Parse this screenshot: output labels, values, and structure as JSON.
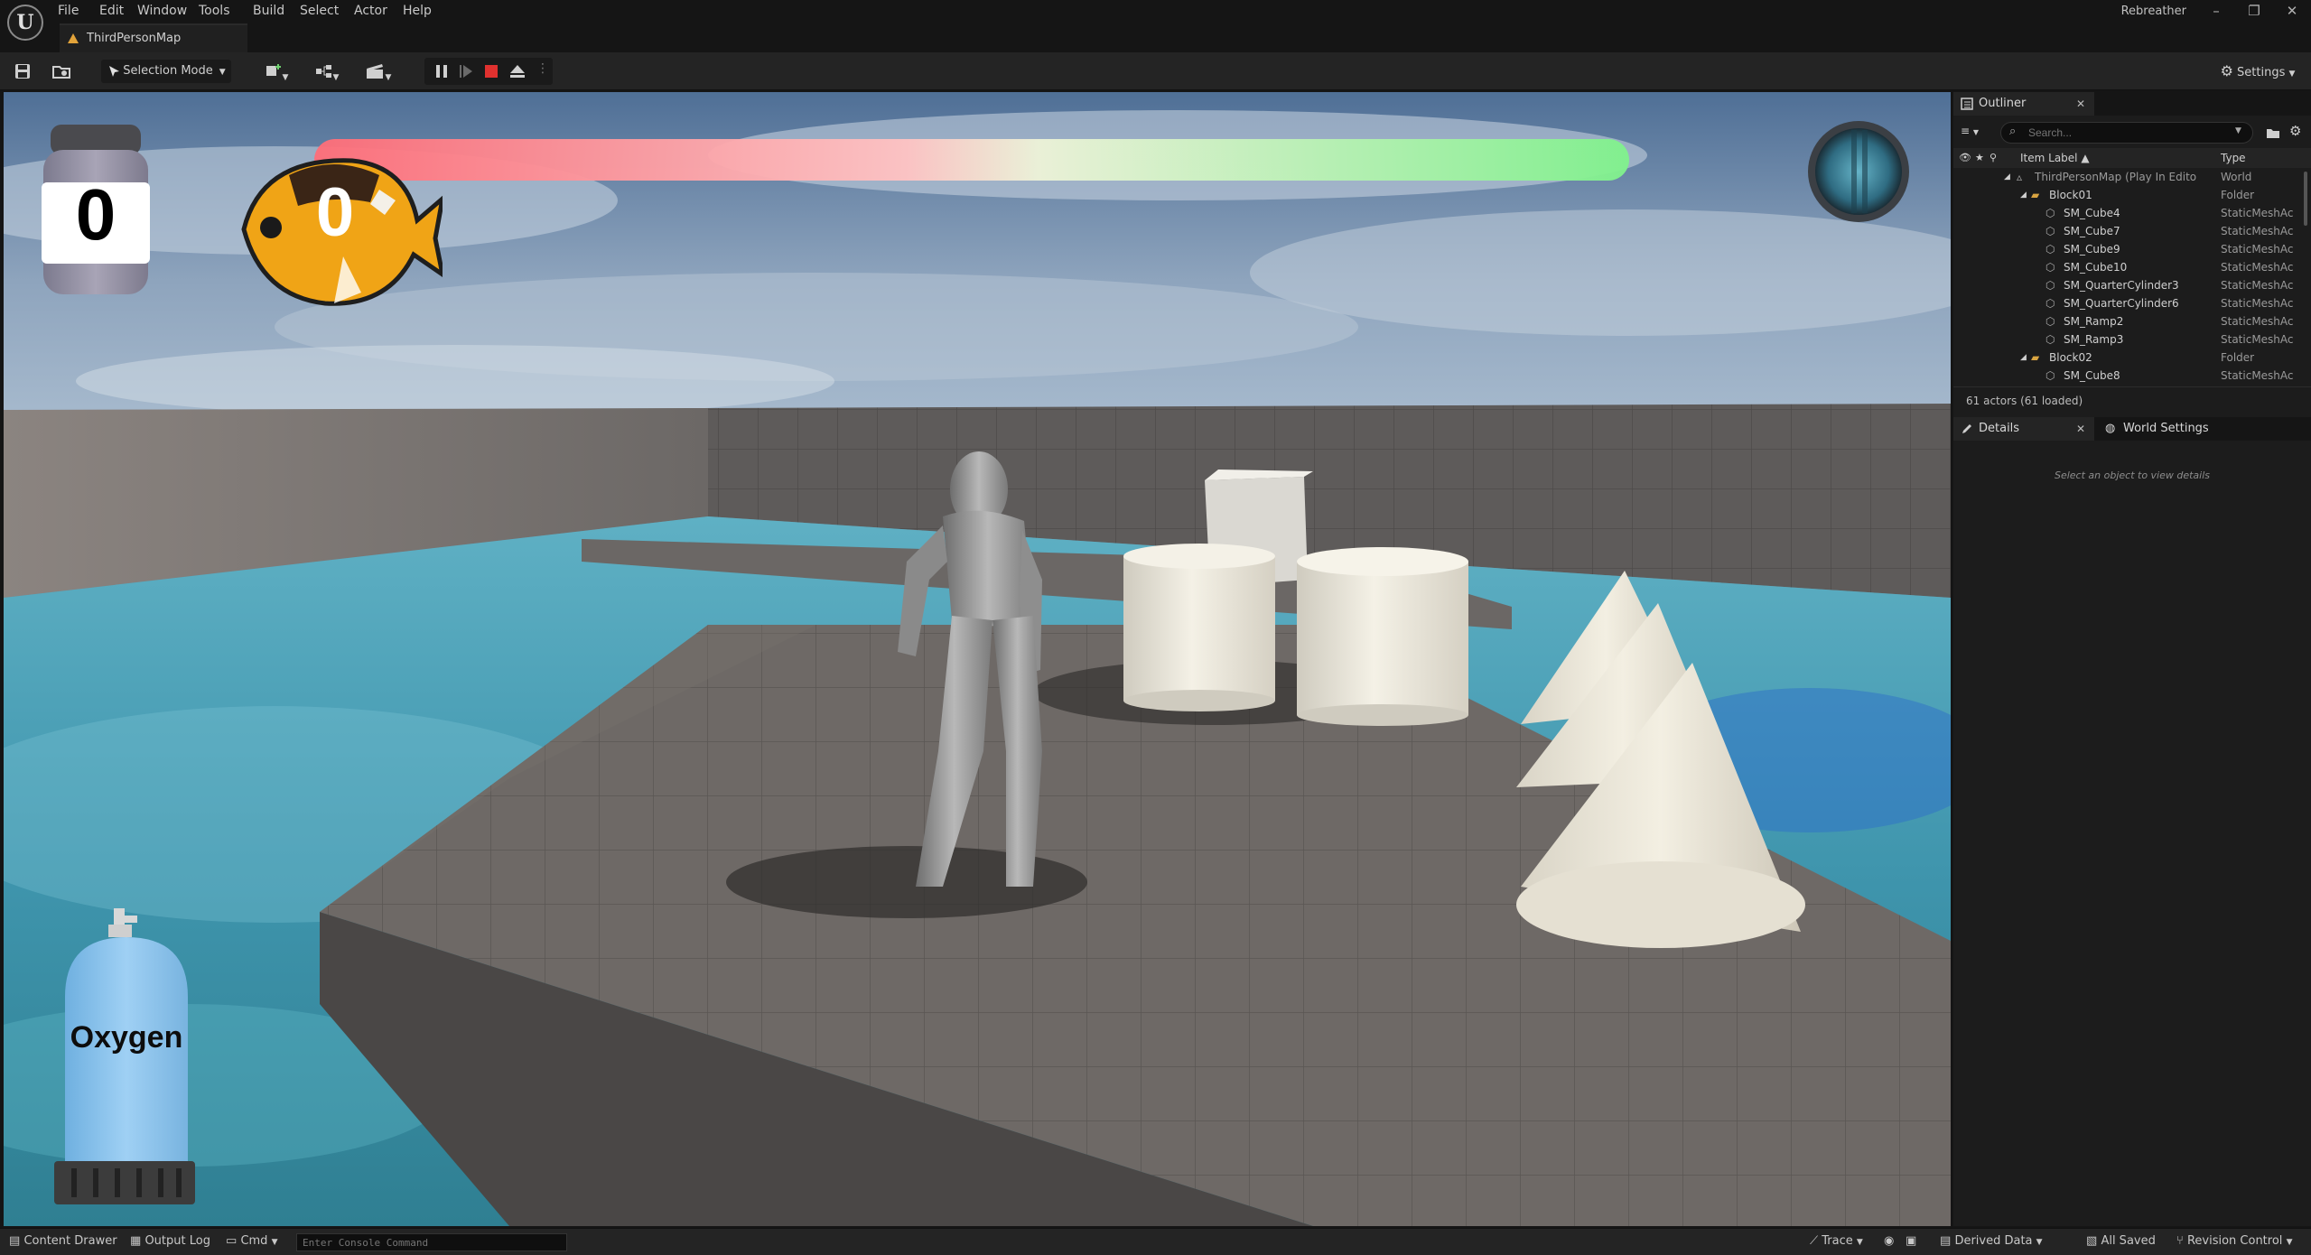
{
  "menu": {
    "items": [
      "File",
      "Edit",
      "Window",
      "Tools",
      "Build",
      "Select",
      "Actor",
      "Help"
    ]
  },
  "document_tab": {
    "label": "ThirdPersonMap"
  },
  "app_name": "Rebreather",
  "window_controls": {
    "minimize": "–",
    "maximize": "❐",
    "close": "✕"
  },
  "toolbar": {
    "selection_mode": "Selection Mode",
    "settings": "Settings"
  },
  "hud": {
    "jar_count": "0",
    "fish_count": "0",
    "oxygen_label": "Oxygen",
    "bar_level": 1.0
  },
  "outliner": {
    "title": "Outliner",
    "search_placeholder": "Search...",
    "columns": {
      "label": "Item Label ▲",
      "type": "Type"
    },
    "rows": [
      {
        "label": "ThirdPersonMap (Play In Edito",
        "type": "World",
        "kind": "world",
        "depth": 0
      },
      {
        "label": "Block01",
        "type": "Folder",
        "kind": "folder",
        "depth": 1
      },
      {
        "label": "SM_Cube4",
        "type": "StaticMeshAc",
        "kind": "mesh",
        "depth": 2
      },
      {
        "label": "SM_Cube7",
        "type": "StaticMeshAc",
        "kind": "mesh",
        "depth": 2
      },
      {
        "label": "SM_Cube9",
        "type": "StaticMeshAc",
        "kind": "mesh",
        "depth": 2
      },
      {
        "label": "SM_Cube10",
        "type": "StaticMeshAc",
        "kind": "mesh",
        "depth": 2
      },
      {
        "label": "SM_QuarterCylinder3",
        "type": "StaticMeshAc",
        "kind": "mesh",
        "depth": 2
      },
      {
        "label": "SM_QuarterCylinder6",
        "type": "StaticMeshAc",
        "kind": "mesh",
        "depth": 2
      },
      {
        "label": "SM_Ramp2",
        "type": "StaticMeshAc",
        "kind": "mesh",
        "depth": 2
      },
      {
        "label": "SM_Ramp3",
        "type": "StaticMeshAc",
        "kind": "mesh",
        "depth": 2
      },
      {
        "label": "Block02",
        "type": "Folder",
        "kind": "folder",
        "depth": 1
      },
      {
        "label": "SM_Cube8",
        "type": "StaticMeshAc",
        "kind": "mesh",
        "depth": 2
      }
    ],
    "actor_count": "61 actors (61 loaded)"
  },
  "details": {
    "tab": "Details",
    "world_settings_tab": "World Settings",
    "empty_message": "Select an object to view details"
  },
  "statusbar": {
    "content_drawer": "Content Drawer",
    "output_log": "Output Log",
    "cmd": "Cmd",
    "console_placeholder": "Enter Console Command",
    "trace": "Trace",
    "derived_data": "Derived Data",
    "all_saved": "All Saved",
    "revision_control": "Revision Control"
  }
}
